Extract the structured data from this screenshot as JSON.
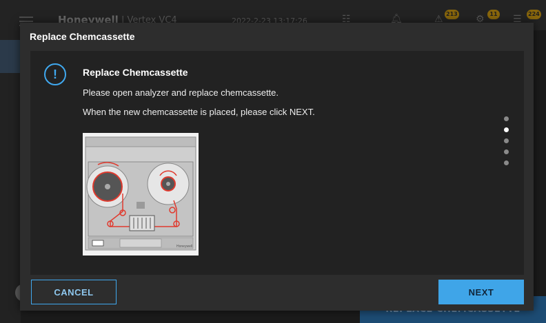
{
  "background": {
    "brand": "Honeywell",
    "product": "| Vertex VC4",
    "datetime": "2022-2-23 13:17:26",
    "badges": [
      "213",
      "11",
      "224"
    ],
    "bottom_button": "REPLACE CHEMCASSETTE"
  },
  "dialog": {
    "title": "Replace Chemcassette",
    "message_title": "Replace Chemcassette",
    "line1": "Please open analyzer and replace chemcassette.",
    "line2": "When the new chemcassette is placed, please click NEXT.",
    "step_count": 5,
    "current_step": 1,
    "cancel_label": "CANCEL",
    "next_label": "NEXT",
    "illustration_label": "Honeywell"
  },
  "colors": {
    "accent": "#40a9f0",
    "primary_button": "#3fa5e8",
    "highlight": "#e03a2e",
    "badge": "#e1a400"
  },
  "icons": {
    "info": "info-icon",
    "menu": "menu-icon"
  }
}
